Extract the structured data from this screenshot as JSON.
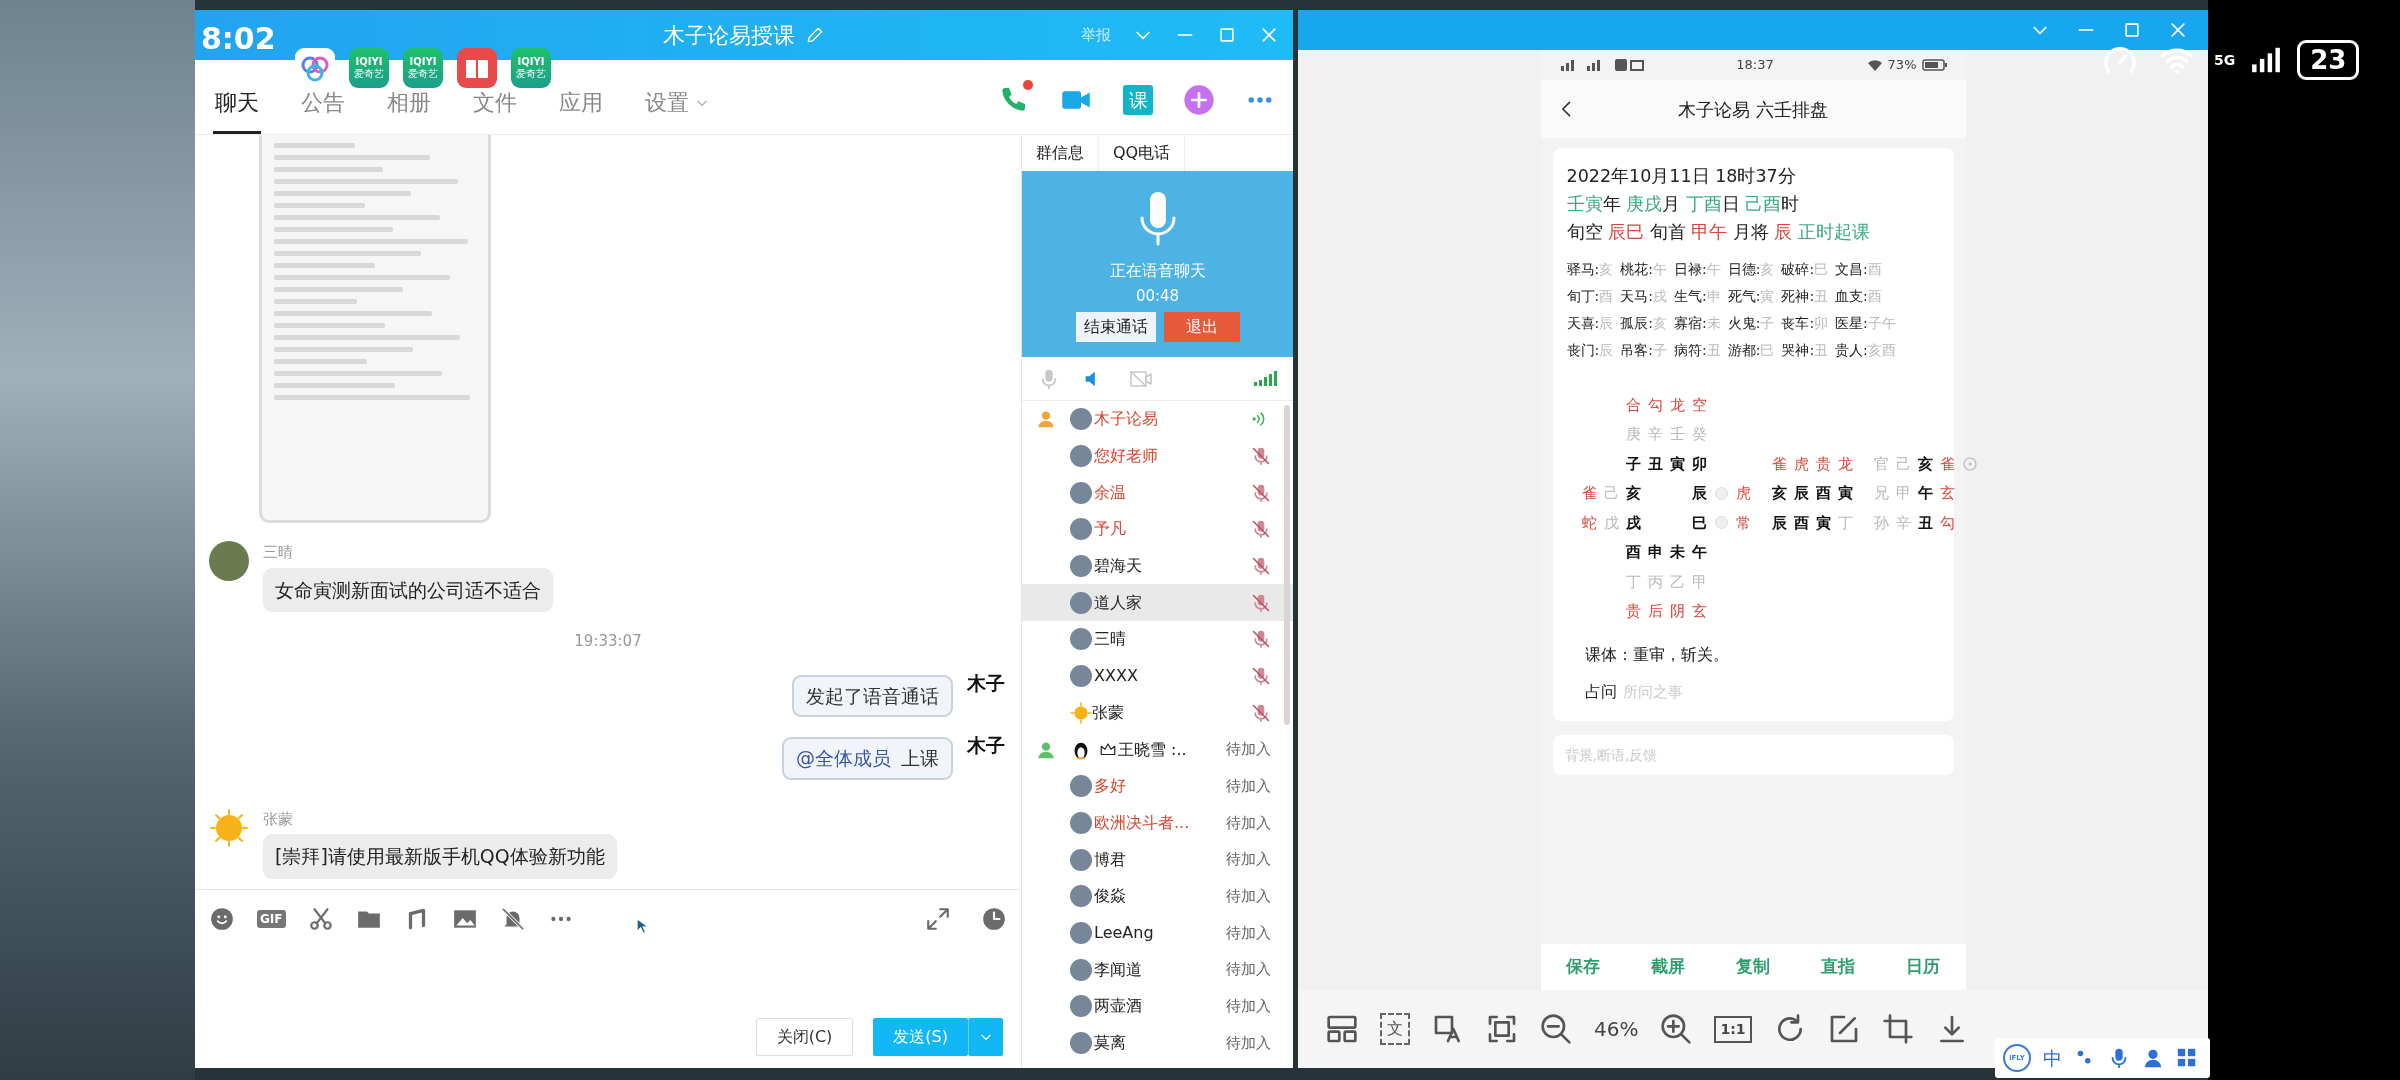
{
  "desktop": {
    "clock": "8:02",
    "apps": [
      {
        "kind": "rings"
      },
      {
        "kind": "iqiyi",
        "label": "IQIYI",
        "caption": "爱奇艺"
      },
      {
        "kind": "iqiyi",
        "label": "IQIYI",
        "caption": "爱奇艺"
      },
      {
        "kind": "book"
      },
      {
        "kind": "iqiyi",
        "label": "IQIYI",
        "caption": "爱奇艺"
      }
    ]
  },
  "chat_window": {
    "title": "木子论易授课",
    "report": "举报",
    "tabs": [
      {
        "label": "聊天",
        "selected": true,
        "dropdown": false
      },
      {
        "label": "公告",
        "selected": false,
        "dropdown": false
      },
      {
        "label": "相册",
        "selected": false,
        "dropdown": false
      },
      {
        "label": "文件",
        "selected": false,
        "dropdown": false
      },
      {
        "label": "应用",
        "selected": false,
        "dropdown": false
      },
      {
        "label": "设置",
        "selected": false,
        "dropdown": true
      }
    ],
    "actions": [
      {
        "kind": "call",
        "badge": true
      },
      {
        "kind": "video"
      },
      {
        "kind": "lesson",
        "label": "课"
      },
      {
        "kind": "add"
      },
      {
        "kind": "more"
      }
    ],
    "messages": [
      {
        "kind": "image"
      },
      {
        "kind": "incoming",
        "sender": "三晴",
        "avatar": {
          "kind": "photo"
        },
        "text": "女命寅测新面试的公司适不适合"
      },
      {
        "kind": "time",
        "text": "19:33:07"
      },
      {
        "kind": "outgoing",
        "avatar_text": "木子",
        "text": "发起了语音通话"
      },
      {
        "kind": "mention",
        "avatar_text": "木子",
        "mention": "@全体成员",
        "text": "上课"
      },
      {
        "kind": "incoming",
        "sender": "张蒙",
        "avatar": {
          "kind": "sun"
        },
        "text": "[崇拜]请使用最新版手机QQ体验新功能"
      }
    ],
    "composer": {
      "tools": [
        {
          "kind": "emoji"
        },
        {
          "kind": "gif",
          "label": "GIF"
        },
        {
          "kind": "scissors"
        },
        {
          "kind": "folder"
        },
        {
          "kind": "music"
        },
        {
          "kind": "image"
        },
        {
          "kind": "bell-off"
        },
        {
          "kind": "more"
        }
      ],
      "close": "关闭(C)",
      "send": "发送(S)"
    },
    "side_panel": {
      "tabs": [
        "群信息",
        "QQ电话"
      ],
      "voice": {
        "status": "正在语音聊天",
        "duration": "00:48",
        "end": "结束通话",
        "exit": "退出"
      },
      "controls": [
        {
          "kind": "mic",
          "on": false
        },
        {
          "kind": "speaker",
          "on": true
        },
        {
          "kind": "camera",
          "on": false
        }
      ],
      "members": [
        {
          "name": "木子论易",
          "color": "#d9452f",
          "role": {
            "kind": "host"
          },
          "avatar": {
            "kind": "photo"
          },
          "status": {
            "kind": "speaking"
          },
          "selected": false
        },
        {
          "name": "您好老师",
          "color": "#d9452f",
          "avatar": {
            "kind": "photo"
          },
          "status": {
            "kind": "muted"
          },
          "selected": false
        },
        {
          "name": "余温",
          "color": "#d9452f",
          "avatar": {
            "kind": "photo"
          },
          "status": {
            "kind": "muted"
          },
          "selected": false
        },
        {
          "name": "予凡",
          "color": "#d9452f",
          "avatar": {
            "kind": "photo"
          },
          "status": {
            "kind": "muted"
          },
          "selected": false
        },
        {
          "name": "碧海天",
          "color": "#222222",
          "avatar": {
            "kind": "photo"
          },
          "status": {
            "kind": "muted"
          },
          "selected": false
        },
        {
          "name": "道人家",
          "color": "#222222",
          "avatar": {
            "kind": "photo"
          },
          "status": {
            "kind": "muted"
          },
          "selected": true
        },
        {
          "name": "三晴",
          "color": "#222222",
          "avatar": {
            "kind": "photo"
          },
          "status": {
            "kind": "muted"
          },
          "selected": false
        },
        {
          "name": "XXXX",
          "color": "#222222",
          "avatar": {
            "kind": "photo"
          },
          "status": {
            "kind": "muted"
          },
          "selected": false
        },
        {
          "name": "张蒙",
          "color": "#222222",
          "avatar": {
            "kind": "sun"
          },
          "status": {
            "kind": "muted"
          },
          "selected": false
        },
        {
          "name": "王晓雪 :..",
          "color": "#222222",
          "role": {
            "kind": "admin"
          },
          "avatar": {
            "kind": "penguin"
          },
          "crown": true,
          "status": {
            "kind": "pending",
            "text": "待加入"
          },
          "selected": false
        },
        {
          "name": "多好",
          "color": "#d9452f",
          "avatar": {
            "kind": "photo"
          },
          "status": {
            "kind": "pending",
            "text": "待加入"
          },
          "selected": false
        },
        {
          "name": "欧洲决斗者...",
          "color": "#d9452f",
          "avatar": {
            "kind": "photo"
          },
          "status": {
            "kind": "pending",
            "text": "待加入"
          },
          "selected": false
        },
        {
          "name": "博君",
          "color": "#222222",
          "avatar": {
            "kind": "photo"
          },
          "status": {
            "kind": "pending",
            "text": "待加入"
          },
          "selected": false
        },
        {
          "name": "俊焱",
          "color": "#222222",
          "avatar": {
            "kind": "photo"
          },
          "status": {
            "kind": "pending",
            "text": "待加入"
          },
          "selected": false
        },
        {
          "name": "LeeAng",
          "color": "#222222",
          "avatar": {
            "kind": "photo"
          },
          "status": {
            "kind": "pending",
            "text": "待加入"
          },
          "selected": false
        },
        {
          "name": "李闻道",
          "color": "#222222",
          "avatar": {
            "kind": "photo"
          },
          "status": {
            "kind": "pending",
            "text": "待加入"
          },
          "selected": false
        },
        {
          "name": "两壶酒",
          "color": "#222222",
          "avatar": {
            "kind": "photo"
          },
          "status": {
            "kind": "pending",
            "text": "待加入"
          },
          "selected": false
        },
        {
          "name": "莫离",
          "color": "#222222",
          "avatar": {
            "kind": "photo"
          },
          "status": {
            "kind": "pending",
            "text": "待加入"
          },
          "selected": false
        }
      ]
    }
  },
  "viewer": {
    "phone": {
      "time": "18:37",
      "battery": "73%",
      "title": "木子论易 六壬排盘",
      "date": "2022年10月11日 18时37分",
      "pillars": [
        {
          "text": "壬寅",
          "kind": "green"
        },
        {
          "text": "年 ",
          "kind": "plain"
        },
        {
          "text": "庚戌",
          "kind": "green"
        },
        {
          "text": "月 ",
          "kind": "plain"
        },
        {
          "text": "丁酉",
          "kind": "green"
        },
        {
          "text": "日 ",
          "kind": "plain"
        },
        {
          "text": "己酉",
          "kind": "green"
        },
        {
          "text": "时",
          "kind": "plain"
        }
      ],
      "xun": [
        {
          "text": "旬空 ",
          "kind": "plain"
        },
        {
          "text": "辰巳",
          "kind": "red"
        },
        {
          "text": " 旬首 ",
          "kind": "plain"
        },
        {
          "text": "甲午",
          "kind": "red"
        },
        {
          "text": " 月将 ",
          "kind": "plain"
        },
        {
          "text": "辰",
          "kind": "red"
        },
        {
          "text": " 正时起课",
          "kind": "green"
        }
      ],
      "shensha": [
        {
          "label": "驿马:",
          "value": "亥"
        },
        {
          "label": "桃花:",
          "value": "午"
        },
        {
          "label": "日禄:",
          "value": "午"
        },
        {
          "label": "日德:",
          "value": "亥"
        },
        {
          "label": "破碎:",
          "value": "巳"
        },
        {
          "label": "文昌:",
          "value": "酉"
        },
        {
          "label": "旬丁:",
          "value": "酉"
        },
        {
          "label": "天马:",
          "value": "戌"
        },
        {
          "label": "生气:",
          "value": "申"
        },
        {
          "label": "死气:",
          "value": "寅"
        },
        {
          "label": "死神:",
          "value": "丑"
        },
        {
          "label": "血支:",
          "value": "酉"
        },
        {
          "label": "天喜:",
          "value": "辰"
        },
        {
          "label": "孤辰:",
          "value": "亥"
        },
        {
          "label": "寡宿:",
          "value": "未"
        },
        {
          "label": "火鬼:",
          "value": "子"
        },
        {
          "label": "丧车:",
          "value": "卯"
        },
        {
          "label": "医星:",
          "value": "子午"
        },
        {
          "label": "丧门:",
          "value": "辰"
        },
        {
          "label": "吊客:",
          "value": "子"
        },
        {
          "label": "病符:",
          "value": "丑"
        },
        {
          "label": "游都:",
          "value": "巳"
        },
        {
          "label": "哭神:",
          "value": "丑"
        },
        {
          "label": "贵人:",
          "value": "亥酉"
        }
      ],
      "plate": {
        "top": [
          [
            {
              "text": "合",
              "kind": "red"
            },
            {
              "text": "勾",
              "kind": "red"
            },
            {
              "text": "龙",
              "kind": "red"
            },
            {
              "text": "空",
              "kind": "red"
            }
          ],
          [
            {
              "text": "庚",
              "kind": "muted"
            },
            {
              "text": "辛",
              "kind": "muted"
            },
            {
              "text": "壬",
              "kind": "muted"
            },
            {
              "text": "癸",
              "kind": "muted"
            }
          ],
          [
            {
              "text": "子",
              "kind": "bold"
            },
            {
              "text": "丑",
              "kind": "bold"
            },
            {
              "text": "寅",
              "kind": "bold"
            },
            {
              "text": "卯",
              "kind": "bold"
            }
          ]
        ],
        "sides": [
          {
            "left": [
              {
                "text": "雀",
                "kind": "red"
              },
              {
                "text": "己",
                "kind": "muted"
              },
              {
                "text": "亥",
                "kind": "bold"
              }
            ],
            "right": [
              {
                "text": "辰",
                "kind": "bold"
              },
              {
                "text": "虎",
                "kind": "red"
              }
            ]
          },
          {
            "left": [
              {
                "text": "蛇",
                "kind": "red"
              },
              {
                "text": "戊",
                "kind": "muted"
              },
              {
                "text": "戌",
                "kind": "bold"
              }
            ],
            "right": [
              {
                "text": "巳",
                "kind": "bold"
              },
              {
                "text": "常",
                "kind": "red"
              }
            ]
          }
        ],
        "bottom": [
          [
            {
              "text": "酉",
              "kind": "bold"
            },
            {
              "text": "申",
              "kind": "bold"
            },
            {
              "text": "未",
              "kind": "bold"
            },
            {
              "text": "午",
              "kind": "bold"
            }
          ],
          [
            {
              "text": "丁",
              "kind": "muted"
            },
            {
              "text": "丙",
              "kind": "muted"
            },
            {
              "text": "乙",
              "kind": "muted"
            },
            {
              "text": "甲",
              "kind": "muted"
            }
          ],
          [
            {
              "text": "贵",
              "kind": "red"
            },
            {
              "text": "后",
              "kind": "red"
            },
            {
              "text": "阴",
              "kind": "red"
            },
            {
              "text": "玄",
              "kind": "red"
            }
          ]
        ]
      },
      "si_ke": [
        [
          {
            "text": "雀",
            "kind": "red"
          },
          {
            "text": "虎",
            "kind": "red"
          },
          {
            "text": "贵",
            "kind": "red"
          },
          {
            "text": "龙",
            "kind": "red"
          }
        ],
        [
          {
            "text": "亥",
            "kind": "bold"
          },
          {
            "text": "辰",
            "kind": "bold"
          },
          {
            "text": "酉",
            "kind": "bold"
          },
          {
            "text": "寅",
            "kind": "bold"
          }
        ],
        [
          {
            "text": "辰",
            "kind": "bold"
          },
          {
            "text": "酉",
            "kind": "bold"
          },
          {
            "text": "寅",
            "kind": "bold"
          },
          {
            "text": "丁",
            "kind": "muted"
          }
        ]
      ],
      "san_chuan": [
        {
          "marked": true,
          "cells": [
            {
              "text": "官",
              "kind": "muted"
            },
            {
              "text": "己",
              "kind": "muted"
            },
            {
              "text": "亥",
              "kind": "bold"
            },
            {
              "text": "雀",
              "kind": "red"
            }
          ]
        },
        {
          "marked": false,
          "cells": [
            {
              "text": "兄",
              "kind": "muted"
            },
            {
              "text": "甲",
              "kind": "muted"
            },
            {
              "text": "午",
              "kind": "bold"
            },
            {
              "text": "玄",
              "kind": "red"
            }
          ]
        },
        {
          "marked": false,
          "cells": [
            {
              "text": "孙",
              "kind": "muted"
            },
            {
              "text": "辛",
              "kind": "muted"
            },
            {
              "text": "丑",
              "kind": "bold"
            },
            {
              "text": "勾",
              "kind": "red"
            }
          ]
        }
      ],
      "ke_ti": "课体：重审，斩关。",
      "question": {
        "label": "占问",
        "placeholder": "所问之事"
      },
      "notes_placeholder": "背景,断语,反馈",
      "buttons": [
        "保存",
        "截屏",
        "复制",
        "直指",
        "日历"
      ]
    },
    "tools": [
      {
        "kind": "layout"
      },
      {
        "kind": "ocr",
        "label": "文"
      },
      {
        "kind": "image-text"
      },
      {
        "kind": "fit"
      },
      {
        "kind": "zoom-out"
      },
      {
        "kind": "zoom",
        "label": "46%"
      },
      {
        "kind": "zoom-in"
      },
      {
        "kind": "actual",
        "label": "1:1"
      },
      {
        "kind": "rotate"
      },
      {
        "kind": "edit"
      },
      {
        "kind": "crop"
      },
      {
        "kind": "download"
      }
    ]
  },
  "ime": {
    "logo": "iFLY",
    "mode": "中"
  },
  "device_status": {
    "network": "5G",
    "battery": "23"
  }
}
